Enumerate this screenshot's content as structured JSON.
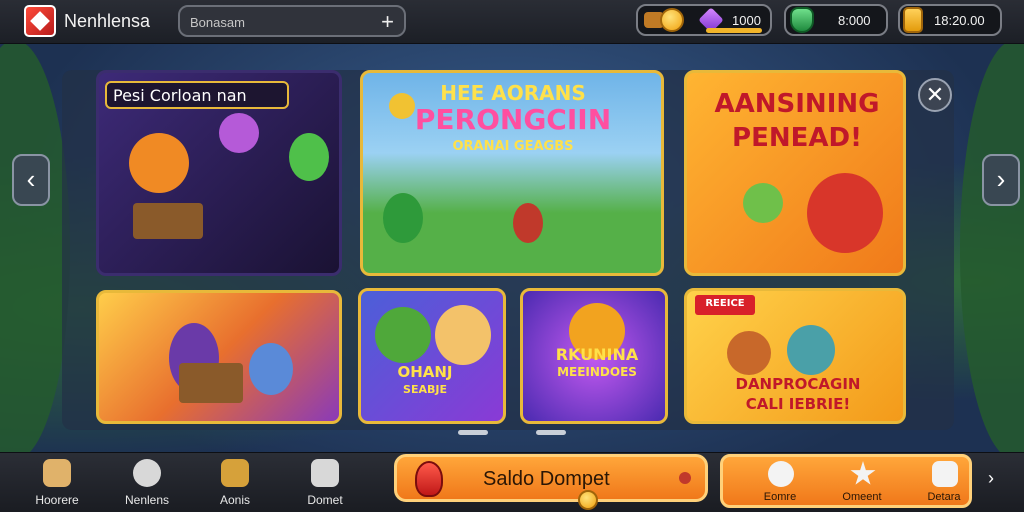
{
  "header": {
    "app_title": "Nenhlensa",
    "search_placeholder": "Bonasam",
    "add_label": "+"
  },
  "currency": [
    {
      "name": "coins",
      "value": "1000"
    },
    {
      "name": "gems",
      "value": "8:000"
    },
    {
      "name": "gold",
      "value": "18:20.00"
    }
  ],
  "cards": [
    {
      "title": "Pesi Corloan nan",
      "theme": "#2e1f55"
    },
    {
      "title_line1": "HEE AORANS",
      "title_line2": "PERONGCIIN",
      "subtitle": "ORANAI GEAGBS",
      "theme": "#48a548"
    },
    {
      "title_line1": "AANSINING",
      "title_line2": "PENEAD!",
      "theme": "#f2a31f"
    },
    {
      "title": "",
      "theme": "#e86f2e"
    },
    {
      "title_line1": "OHANJ",
      "title_line2": "SEABJE",
      "theme": "#6a3fb0"
    },
    {
      "title_line1": "RKUNINA",
      "title_line2": "MEEINDOES",
      "theme": "#8c3ad6"
    },
    {
      "badge": "REEICE",
      "title_line1": "DANPROCAGIN",
      "title_line2": "CALI IEBRIE!",
      "theme": "#f6b532"
    }
  ],
  "bottom_nav": [
    {
      "label": "Hoorere",
      "icon": "home-icon"
    },
    {
      "label": "Nenlens",
      "icon": "gear-icon"
    },
    {
      "label": "Aonis",
      "icon": "chest-icon"
    },
    {
      "label": "Domet",
      "icon": "puzzle-icon"
    }
  ],
  "main_action": {
    "label": "Saldo Dompet"
  },
  "right_nav": [
    {
      "label": "Eomre",
      "icon": "cloud-icon"
    },
    {
      "label": "Omeent",
      "icon": "star-icon"
    },
    {
      "label": "Detara",
      "icon": "dice-icon"
    }
  ],
  "colors": {
    "accent": "#f08a24",
    "frame": "#e8b93a",
    "topbar": "#1c1f26"
  }
}
